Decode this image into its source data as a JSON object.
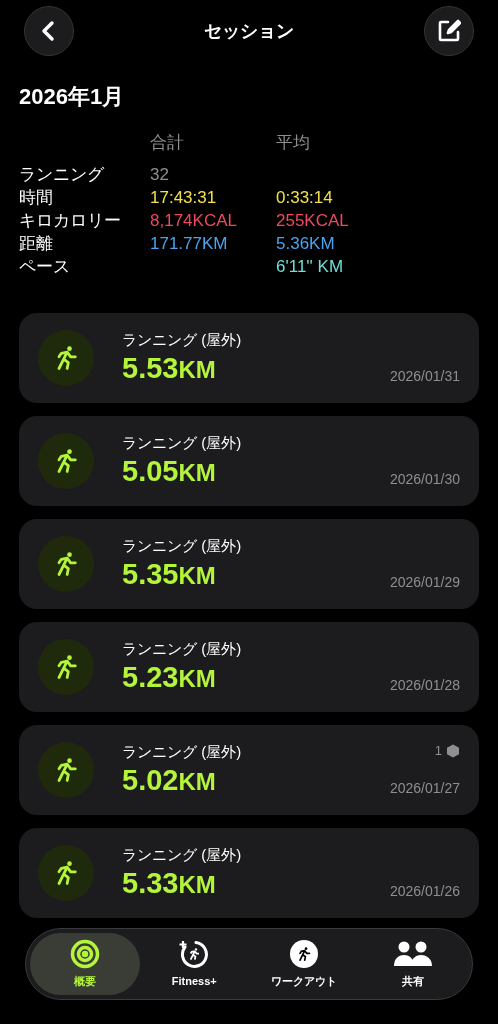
{
  "header": {
    "title": "セッション"
  },
  "month": "2026年1月",
  "summary": {
    "columns": [
      "合計",
      "平均"
    ],
    "rows": [
      {
        "label": "ランニング",
        "total": "32",
        "average": null,
        "color": "#8e8e93"
      },
      {
        "label": "時間",
        "total": "17:43:31",
        "average": "0:33:14",
        "color": "#f2e24b"
      },
      {
        "label": "キロカロリー",
        "total": "8,174KCAL",
        "average": "255KCAL",
        "color": "#eb4a5f"
      },
      {
        "label": "距離",
        "total": "171.77KM",
        "average": "5.36KM",
        "color": "#4aa3f0"
      },
      {
        "label": "ペース",
        "total": null,
        "average": "6'11'' KM",
        "color": "#6ee0d8"
      }
    ]
  },
  "sessions": [
    {
      "title": "ランニング (屋外)",
      "distance": "5.53",
      "unit": "KM",
      "date": "2026/01/31"
    },
    {
      "title": "ランニング (屋外)",
      "distance": "5.05",
      "unit": "KM",
      "date": "2026/01/30"
    },
    {
      "title": "ランニング (屋外)",
      "distance": "5.35",
      "unit": "KM",
      "date": "2026/01/29"
    },
    {
      "title": "ランニング (屋外)",
      "distance": "5.23",
      "unit": "KM",
      "date": "2026/01/28"
    },
    {
      "title": "ランニング (屋外)",
      "distance": "5.02",
      "unit": "KM",
      "date": "2026/01/27",
      "badge": "1"
    },
    {
      "title": "ランニング (屋外)",
      "distance": "5.33",
      "unit": "KM",
      "date": "2026/01/26"
    }
  ],
  "tab_bar": [
    {
      "kind": "summary",
      "label": "概要",
      "selected": true
    },
    {
      "kind": "fitness",
      "label": "Fitness+",
      "selected": false
    },
    {
      "kind": "workout",
      "label": "ワークアウト",
      "selected": false
    },
    {
      "kind": "sharing",
      "label": "共有",
      "selected": false
    }
  ]
}
